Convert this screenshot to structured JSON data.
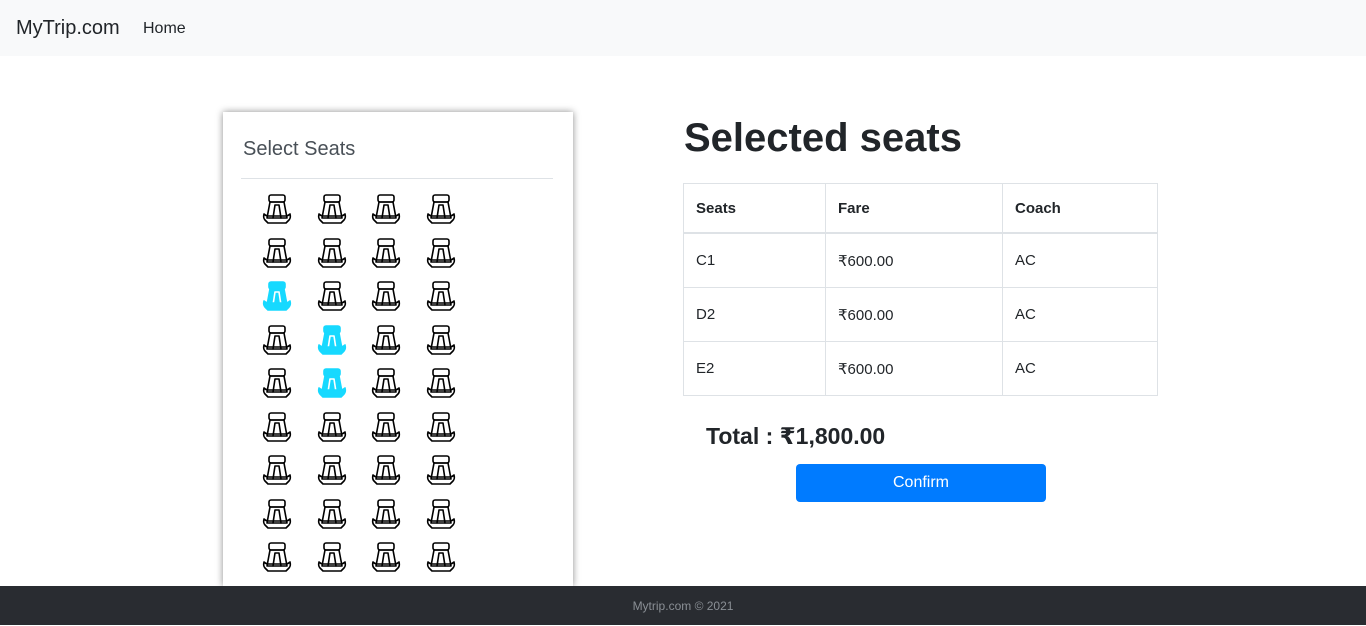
{
  "navbar": {
    "brand": "MyTrip.com",
    "home_label": "Home"
  },
  "seat_selector": {
    "title": "Select Seats",
    "icon": "car-seat-icon",
    "selected_color": "#17d9ff",
    "rows": [
      [
        false,
        false,
        false,
        false
      ],
      [
        false,
        false,
        false,
        false
      ],
      [
        true,
        false,
        false,
        false
      ],
      [
        false,
        true,
        false,
        false
      ],
      [
        false,
        true,
        false,
        false
      ],
      [
        false,
        false,
        false,
        false
      ],
      [
        false,
        false,
        false,
        false
      ],
      [
        false,
        false,
        false,
        false
      ],
      [
        false,
        false,
        false,
        false
      ]
    ]
  },
  "selected": {
    "heading": "Selected seats",
    "columns": [
      "Seats",
      "Fare",
      "Coach"
    ],
    "rows": [
      {
        "seat": "C1",
        "fare": "₹600.00",
        "coach": "AC"
      },
      {
        "seat": "D2",
        "fare": "₹600.00",
        "coach": "AC"
      },
      {
        "seat": "E2",
        "fare": "₹600.00",
        "coach": "AC"
      }
    ],
    "total": "Total : ₹1,800.00",
    "confirm_label": "Confirm",
    "accent": "#007bff"
  },
  "footer": {
    "text": "Mytrip.com © 2021"
  }
}
